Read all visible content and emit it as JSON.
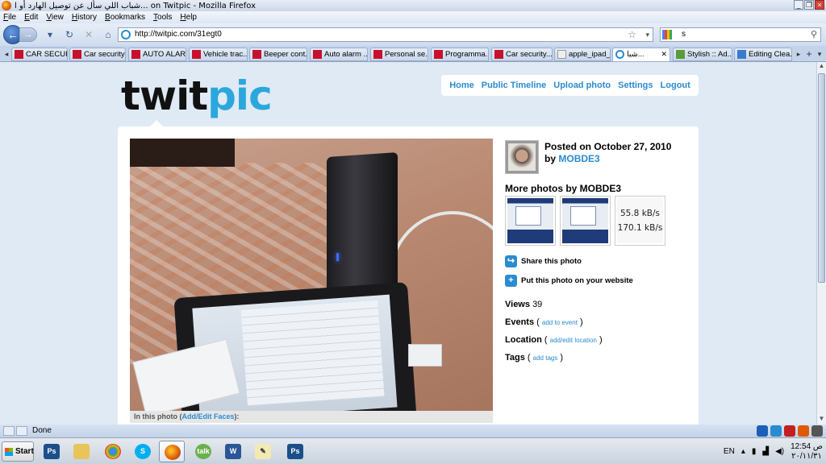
{
  "window": {
    "title": "شباب اللي سأل عن توصيل الهارد أو ا... on Twitpic - Mozilla Firefox"
  },
  "menu": [
    "File",
    "Edit",
    "View",
    "History",
    "Bookmarks",
    "Tools",
    "Help"
  ],
  "nav": {
    "url": "http://twitpic.com/31egt0",
    "search_value": "s"
  },
  "tabs": [
    {
      "label": "CAR SECUR..."
    },
    {
      "label": "Car security ..."
    },
    {
      "label": "AUTO ALAR..."
    },
    {
      "label": "Vehicle trac..."
    },
    {
      "label": "Beeper cont..."
    },
    {
      "label": "Auto alarm ..."
    },
    {
      "label": "Personal se..."
    },
    {
      "label": "Programma..."
    },
    {
      "label": "Car security..."
    },
    {
      "label": "apple_ipad_..."
    },
    {
      "label": "شبا..."
    },
    {
      "label": "Stylish :: Ad..."
    },
    {
      "label": "Editing Clea..."
    }
  ],
  "site": {
    "logo_twit": "twit",
    "logo_pic": "pic",
    "nav": [
      "Home",
      "Public Timeline",
      "Upload photo",
      "Settings",
      "Logout"
    ]
  },
  "photo": {
    "caption_prefix": "In this photo (",
    "caption_link": "Add/Edit Faces",
    "caption_suffix": "):"
  },
  "sidebar": {
    "posted_on": "Posted on October 27, 2010",
    "by": "by",
    "user": "MOBDE3",
    "more_title": "More photos by MOBDE3",
    "speed_1": "55.8 kB/s",
    "speed_2": "170.1 kB/s",
    "share": "Share this photo",
    "embed": "Put this photo on your website",
    "views_label": "Views",
    "views_value": "39",
    "events_label": "Events",
    "events_link": "add to event",
    "location_label": "Location",
    "location_link": "add/edit location",
    "tags_label": "Tags",
    "tags_link": "add tags"
  },
  "status": {
    "text": "Done"
  },
  "taskbar": {
    "start": "Start",
    "lang": "EN",
    "time": "12:54 ص",
    "date": "٢٠/١١/٣١"
  },
  "colors": {
    "link": "#2a8bd0",
    "logo_pic": "#2aa8dd"
  }
}
